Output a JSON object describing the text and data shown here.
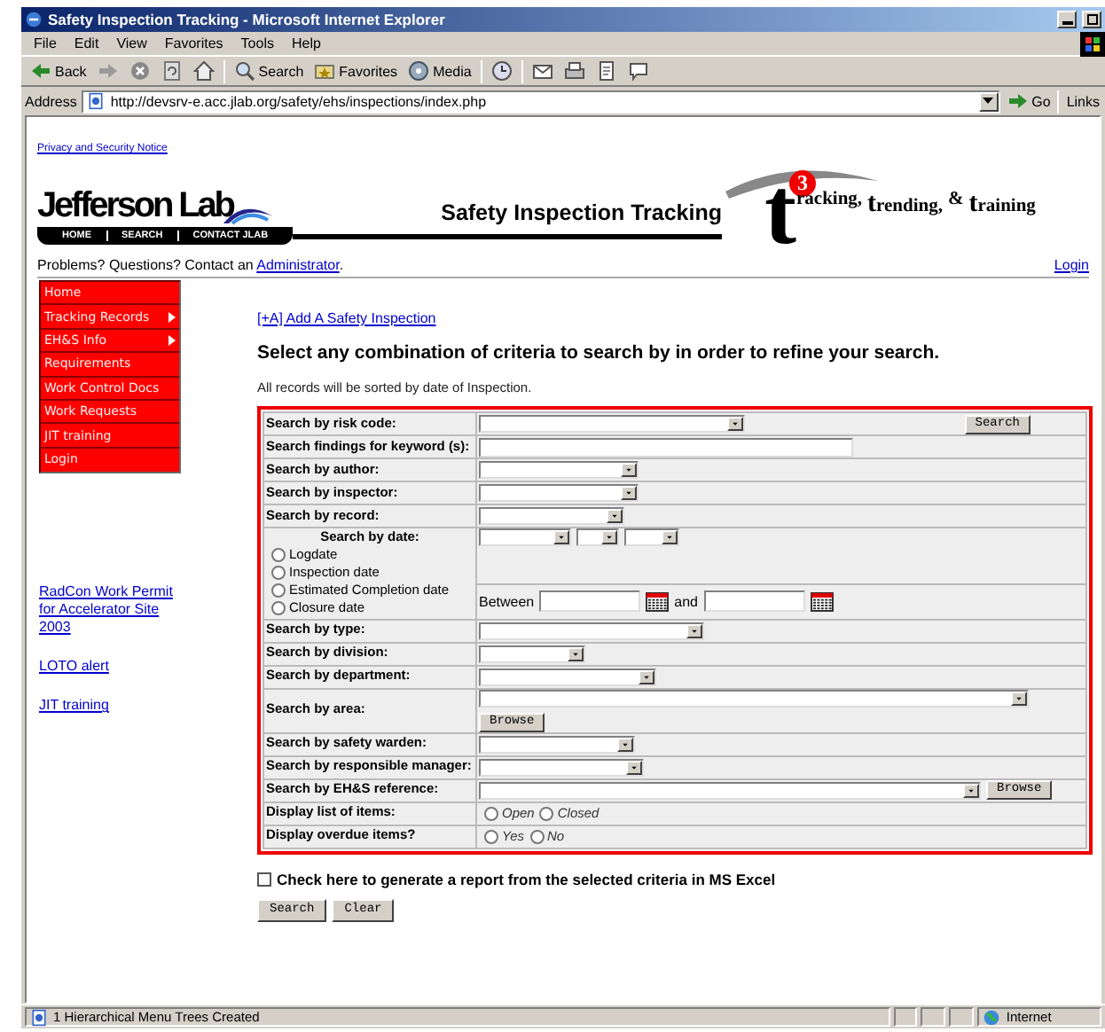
{
  "window": {
    "title": "Safety Inspection Tracking - Microsoft Internet Explorer"
  },
  "menu": [
    "File",
    "Edit",
    "View",
    "Favorites",
    "Tools",
    "Help"
  ],
  "toolbar": [
    {
      "kind": "back",
      "label": "Back"
    },
    {
      "kind": "forward"
    },
    {
      "kind": "stop"
    },
    {
      "kind": "refresh"
    },
    {
      "kind": "home"
    },
    {
      "kind": "search",
      "label": "Search"
    },
    {
      "kind": "favorites",
      "label": "Favorites"
    },
    {
      "kind": "media",
      "label": "Media"
    },
    {
      "kind": "history"
    },
    {
      "kind": "mail"
    },
    {
      "kind": "print"
    },
    {
      "kind": "edit"
    },
    {
      "kind": "discuss"
    }
  ],
  "address": {
    "label": "Address",
    "url": "http://devsrv-e.acc.jlab.org/safety/ehs/inspections/index.php",
    "go": "Go",
    "links": "Links"
  },
  "page": {
    "privacy_link": "Privacy and Security Notice",
    "logo": {
      "name": "Jefferson Lab",
      "nav": [
        "HOME",
        "SEARCH",
        "CONTACT JLAB"
      ]
    },
    "title": "Safety Inspection Tracking",
    "t3_logo": {
      "letter": "t",
      "badge": "3",
      "words": [
        "racking,",
        "trending,",
        "&",
        "training"
      ]
    },
    "contact": {
      "text": "Problems? Questions? Contact an ",
      "link": "Administrator",
      "end": "."
    },
    "login": "Login"
  },
  "sidebar": {
    "menu": [
      {
        "label": "Home",
        "submenu": false
      },
      {
        "label": "Tracking Records",
        "submenu": true
      },
      {
        "label": "EH&S Info",
        "submenu": true
      },
      {
        "label": "Requirements",
        "submenu": false
      },
      {
        "label": "Work Control Docs",
        "submenu": false
      },
      {
        "label": "Work Requests",
        "submenu": false
      },
      {
        "label": "JIT training",
        "submenu": false
      },
      {
        "label": "Login",
        "submenu": false
      }
    ],
    "links": [
      "RadCon Work Permit for Accelerator Site 2003",
      "LOTO alert",
      "JIT training"
    ]
  },
  "main": {
    "add_link": "[+A] Add A Safety Inspection",
    "heading": "Select any combination of criteria to search by in order to refine your search.",
    "note": "All records will be sorted by date of Inspection.",
    "rows": [
      {
        "kind": "select",
        "label": "Search by risk code:",
        "button": "Search"
      },
      {
        "kind": "text",
        "label": "Search findings for keyword (s):"
      },
      {
        "kind": "select",
        "label": "Search by author:"
      },
      {
        "kind": "select",
        "label": "Search by inspector:"
      },
      {
        "kind": "select",
        "label": "Search by record:"
      },
      {
        "kind": "date",
        "label": "Search by date:",
        "options": [
          {
            "label": "Logdate",
            "selected": false
          },
          {
            "label": "Inspection date",
            "selected": false
          },
          {
            "label": "Estimated Completion date",
            "selected": false
          },
          {
            "label": "Closure date",
            "selected": false
          }
        ],
        "between": "Between",
        "and": "and"
      },
      {
        "kind": "select",
        "label": "Search by type:"
      },
      {
        "kind": "select",
        "label": "Search by division:"
      },
      {
        "kind": "select",
        "label": "Search by department:"
      },
      {
        "kind": "browse",
        "label": "Search by area:",
        "button": "Browse"
      },
      {
        "kind": "select",
        "label": "Search by safety warden:"
      },
      {
        "kind": "select",
        "label": "Search by responsible manager:"
      },
      {
        "kind": "select",
        "label": "Search by EH&S reference:",
        "button": "Browse"
      },
      {
        "kind": "radio",
        "label": "Display list of items:",
        "options": [
          {
            "label": "Open",
            "selected": false
          },
          {
            "label": "Closed",
            "selected": false
          }
        ]
      },
      {
        "kind": "radio",
        "label": "Display overdue items?",
        "options": [
          {
            "label": "Yes",
            "selected": false
          },
          {
            "label": "No",
            "selected": false
          }
        ]
      }
    ],
    "excel": {
      "label": "Check here to generate a report from the selected criteria in MS Excel",
      "checked": false
    },
    "buttons": [
      "Search",
      "Clear"
    ]
  },
  "status_bar": {
    "text": "1 Hierarchical Menu Trees Created",
    "zone": "Internet"
  }
}
